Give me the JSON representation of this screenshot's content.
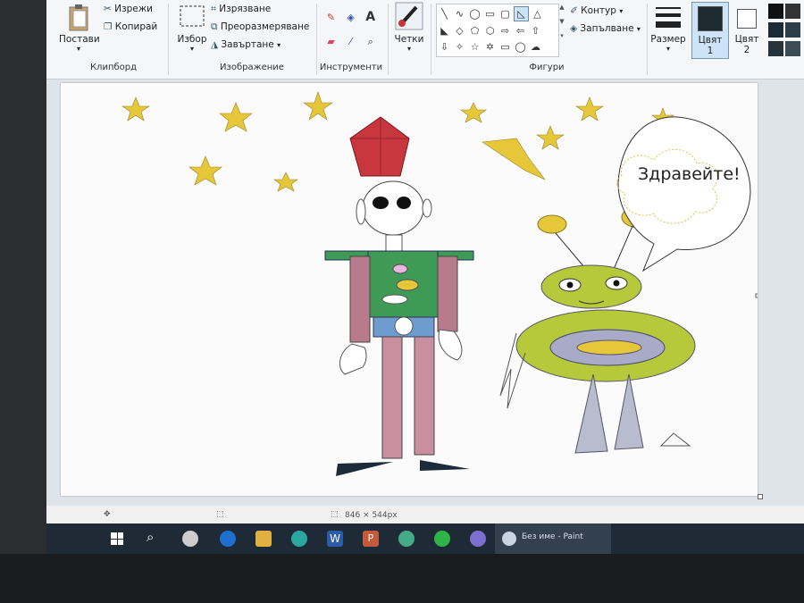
{
  "ribbon": {
    "clipboard": {
      "paste": "Постави",
      "cut": "Изрежи",
      "copy": "Копирай",
      "group": "Клипборд"
    },
    "image": {
      "select": "Избор",
      "crop": "Изрязване",
      "resize": "Преоразмеряване",
      "rotate": "Завъртане",
      "group": "Изображение"
    },
    "tools": {
      "group": "Инструменти"
    },
    "brushes": {
      "label": "Четки"
    },
    "shapes": {
      "outline": "Контур",
      "fill": "Запълване",
      "group": "Фигури"
    },
    "size": {
      "label": "Размер"
    },
    "color1": {
      "label": "Цвят",
      "num": "1"
    },
    "color2": {
      "label": "Цвят",
      "num": "2"
    }
  },
  "canvas": {
    "speech_text": "Здравейте!"
  },
  "statusbar": {
    "dimensions": "846 × 544px"
  },
  "taskbar": {
    "active_app": "Без име - Paint"
  },
  "colors": {
    "star": "#e6c73a",
    "robot_hat": "#c8373d",
    "alien": "#b5c93a"
  }
}
